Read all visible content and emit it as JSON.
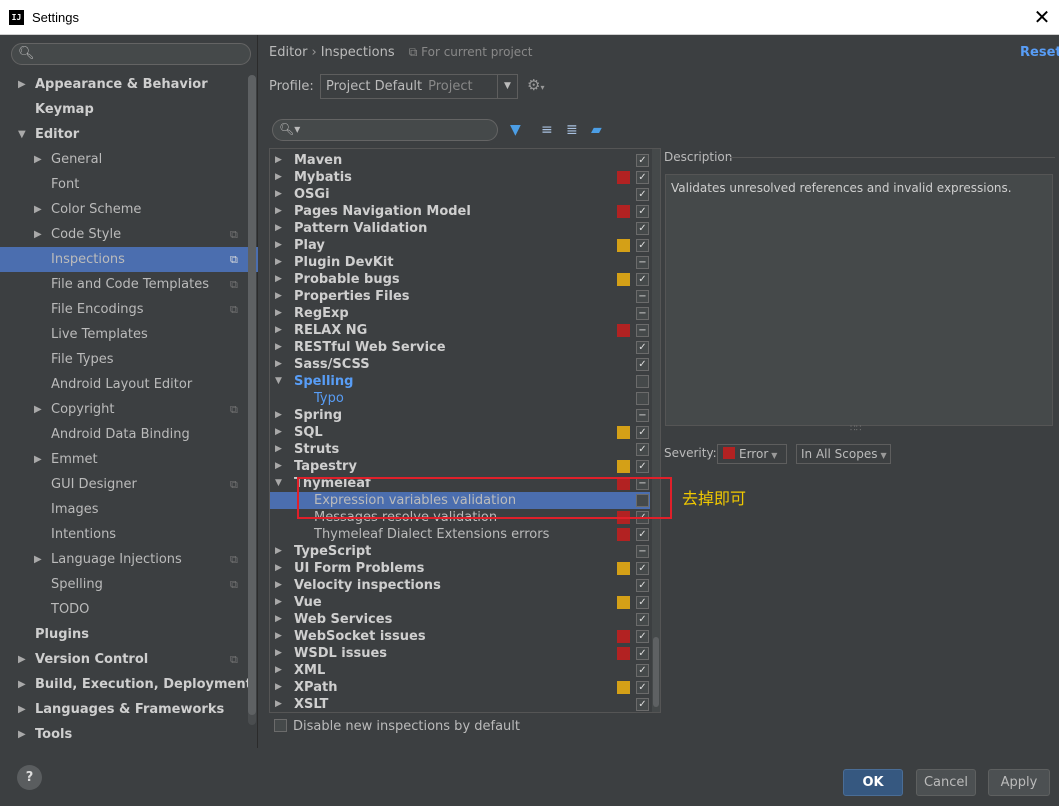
{
  "window": {
    "title": "Settings",
    "icon_text": "IJ",
    "close_glyph": "✕"
  },
  "sidebar": {
    "search_icon": "search-icon",
    "items": [
      {
        "label": "Appearance & Behavior",
        "level": 0,
        "bold": true,
        "arrow": "▶"
      },
      {
        "label": "Keymap",
        "level": 0,
        "bold": true,
        "arrow": ""
      },
      {
        "label": "Editor",
        "level": 0,
        "bold": true,
        "arrow": "▼"
      },
      {
        "label": "General",
        "level": 1,
        "arrow": "▶"
      },
      {
        "label": "Font",
        "level": 1,
        "arrow": ""
      },
      {
        "label": "Color Scheme",
        "level": 1,
        "arrow": "▶"
      },
      {
        "label": "Code Style",
        "level": 1,
        "arrow": "▶",
        "copy": true
      },
      {
        "label": "Inspections",
        "level": 1,
        "arrow": "",
        "copy": true,
        "selected": true
      },
      {
        "label": "File and Code Templates",
        "level": 1,
        "arrow": "",
        "copy": true
      },
      {
        "label": "File Encodings",
        "level": 1,
        "arrow": "",
        "copy": true
      },
      {
        "label": "Live Templates",
        "level": 1,
        "arrow": ""
      },
      {
        "label": "File Types",
        "level": 1,
        "arrow": ""
      },
      {
        "label": "Android Layout Editor",
        "level": 1,
        "arrow": ""
      },
      {
        "label": "Copyright",
        "level": 1,
        "arrow": "▶",
        "copy": true
      },
      {
        "label": "Android Data Binding",
        "level": 1,
        "arrow": ""
      },
      {
        "label": "Emmet",
        "level": 1,
        "arrow": "▶"
      },
      {
        "label": "GUI Designer",
        "level": 1,
        "arrow": "",
        "copy": true
      },
      {
        "label": "Images",
        "level": 1,
        "arrow": ""
      },
      {
        "label": "Intentions",
        "level": 1,
        "arrow": ""
      },
      {
        "label": "Language Injections",
        "level": 1,
        "arrow": "▶",
        "copy": true
      },
      {
        "label": "Spelling",
        "level": 1,
        "arrow": "",
        "copy": true
      },
      {
        "label": "TODO",
        "level": 1,
        "arrow": ""
      },
      {
        "label": "Plugins",
        "level": 0,
        "bold": true,
        "arrow": ""
      },
      {
        "label": "Version Control",
        "level": 0,
        "bold": true,
        "arrow": "▶",
        "copy": true
      },
      {
        "label": "Build, Execution, Deployment",
        "level": 0,
        "bold": true,
        "arrow": "▶"
      },
      {
        "label": "Languages & Frameworks",
        "level": 0,
        "bold": true,
        "arrow": "▶"
      },
      {
        "label": "Tools",
        "level": 0,
        "bold": true,
        "arrow": "▶"
      }
    ]
  },
  "header": {
    "crumb_1": "Editor",
    "crumb_sep": "›",
    "crumb_2": "Inspections",
    "scope_note": "For current project",
    "reset": "Reset",
    "profile_label": "Profile:",
    "profile_value": "Project Default",
    "profile_scope": "Project"
  },
  "colors": {
    "error": "#b22222",
    "warning": "#d4a017",
    "accent": "#4b6eaf",
    "link": "#589df6",
    "annotation": "#e0202a"
  },
  "inspections": [
    {
      "label": "Maven",
      "type": "group",
      "sev": "",
      "check": "✓"
    },
    {
      "label": "Mybatis",
      "type": "group",
      "sev": "error",
      "check": "✓"
    },
    {
      "label": "OSGi",
      "type": "group",
      "sev": "",
      "check": "✓"
    },
    {
      "label": "Pages Navigation Model",
      "type": "group",
      "sev": "error",
      "check": "✓"
    },
    {
      "label": "Pattern Validation",
      "type": "group",
      "sev": "",
      "check": "✓"
    },
    {
      "label": "Play",
      "type": "group",
      "sev": "warning",
      "check": "✓"
    },
    {
      "label": "Plugin DevKit",
      "type": "group",
      "sev": "",
      "check": "−"
    },
    {
      "label": "Probable bugs",
      "type": "group",
      "sev": "warning",
      "check": "✓"
    },
    {
      "label": "Properties Files",
      "type": "group",
      "sev": "",
      "check": "−"
    },
    {
      "label": "RegExp",
      "type": "group",
      "sev": "",
      "check": "−"
    },
    {
      "label": "RELAX NG",
      "type": "group",
      "sev": "error",
      "check": "−"
    },
    {
      "label": "RESTful Web Service",
      "type": "group",
      "sev": "",
      "check": "✓"
    },
    {
      "label": "Sass/SCSS",
      "type": "group",
      "sev": "",
      "check": "✓"
    },
    {
      "label": "Spelling",
      "type": "group-open",
      "sev": "",
      "check": ""
    },
    {
      "label": "Typo",
      "type": "leaf-blue",
      "sev": "",
      "check": ""
    },
    {
      "label": "Spring",
      "type": "group",
      "sev": "",
      "check": "−"
    },
    {
      "label": "SQL",
      "type": "group",
      "sev": "warning",
      "check": "✓"
    },
    {
      "label": "Struts",
      "type": "group",
      "sev": "",
      "check": "✓"
    },
    {
      "label": "Tapestry",
      "type": "group",
      "sev": "warning",
      "check": "✓"
    },
    {
      "label": "Thymeleaf",
      "type": "group-open",
      "sev": "error",
      "check": "−"
    },
    {
      "label": "Expression variables validation",
      "type": "leaf",
      "sev": "",
      "check": "",
      "selected": true
    },
    {
      "label": "Messages resolve validation",
      "type": "leaf",
      "sev": "error",
      "check": "✓"
    },
    {
      "label": "Thymeleaf Dialect Extensions errors",
      "type": "leaf",
      "sev": "error",
      "check": "✓"
    },
    {
      "label": "TypeScript",
      "type": "group",
      "sev": "",
      "check": "−"
    },
    {
      "label": "UI Form Problems",
      "type": "group",
      "sev": "warning",
      "check": "✓"
    },
    {
      "label": "Velocity inspections",
      "type": "group",
      "sev": "",
      "check": "✓"
    },
    {
      "label": "Vue",
      "type": "group",
      "sev": "warning",
      "check": "✓"
    },
    {
      "label": "Web Services",
      "type": "group",
      "sev": "",
      "check": "✓"
    },
    {
      "label": "WebSocket issues",
      "type": "group",
      "sev": "error",
      "check": "✓"
    },
    {
      "label": "WSDL issues",
      "type": "group",
      "sev": "error",
      "check": "✓"
    },
    {
      "label": "XML",
      "type": "group",
      "sev": "",
      "check": "✓"
    },
    {
      "label": "XPath",
      "type": "group",
      "sev": "warning",
      "check": "✓"
    },
    {
      "label": "XSLT",
      "type": "group",
      "sev": "",
      "check": "✓"
    }
  ],
  "disable_new_label": "Disable new inspections by default",
  "annotation_note": "去掉即可",
  "description": {
    "label": "Description",
    "text": "Validates unresolved references and invalid expressions.",
    "severity_label": "Severity:",
    "severity_value": "Error",
    "scope_value": "In All Scopes"
  },
  "footer": {
    "help": "?",
    "ok": "OK",
    "cancel": "Cancel",
    "apply": "Apply"
  }
}
